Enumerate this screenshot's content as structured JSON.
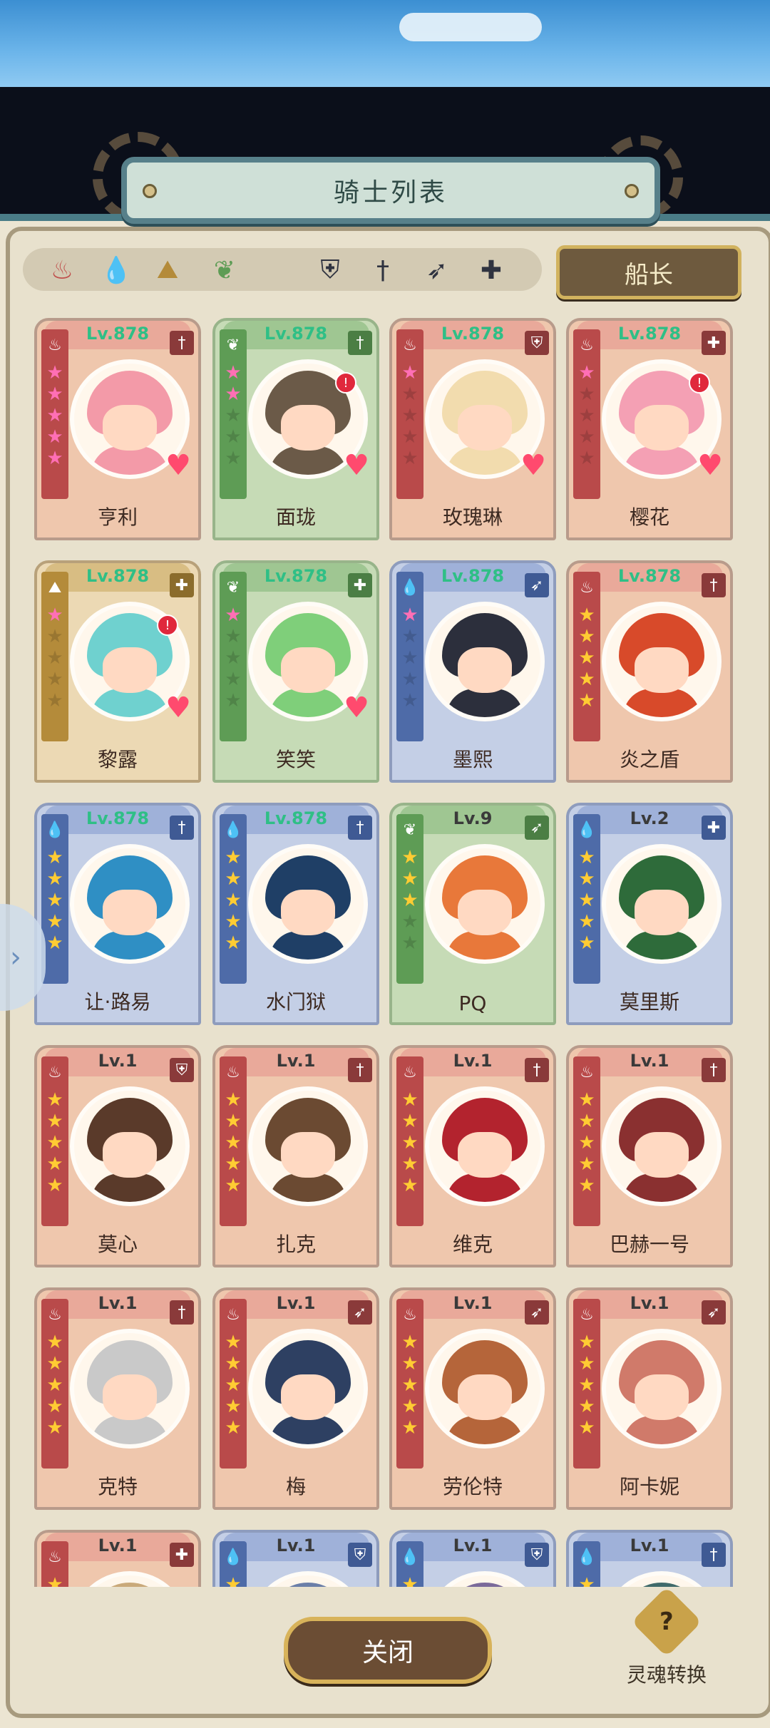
{
  "title": "骑士列表",
  "captain_button": "船长",
  "close_button": "关闭",
  "soul_convert": "灵魂转换",
  "soul_icon_glyph": "?",
  "filters": {
    "elements": [
      {
        "name": "fire-filter-icon",
        "glyph": "♨",
        "color": "#c0504d"
      },
      {
        "name": "water-filter-icon",
        "glyph": "💧",
        "color": "#4e6ba8"
      },
      {
        "name": "earth-filter-icon",
        "glyph": "⛰",
        "color": "#b48b3a"
      },
      {
        "name": "wood-filter-icon",
        "glyph": "❦",
        "color": "#5e9c55"
      }
    ],
    "classes": [
      {
        "name": "shield-filter-icon",
        "glyph": "⛨"
      },
      {
        "name": "sword-filter-icon",
        "glyph": "†"
      },
      {
        "name": "bow-filter-icon",
        "glyph": "➶"
      },
      {
        "name": "cross-filter-icon",
        "glyph": "✚"
      }
    ]
  },
  "knights": [
    {
      "name": "亨利",
      "level": "Lv.878",
      "max": true,
      "element": "fire",
      "stars": {
        "pink": 5,
        "gold": 0
      },
      "class_glyph": "†",
      "heart": true,
      "alert": false,
      "hair": "#f39aa8"
    },
    {
      "name": "面珑",
      "level": "Lv.878",
      "max": true,
      "element": "wood",
      "stars": {
        "pink": 2,
        "gold": 0
      },
      "class_glyph": "†",
      "heart": true,
      "alert": true,
      "hair": "#6b5a48"
    },
    {
      "name": "玫瑰琳",
      "level": "Lv.878",
      "max": true,
      "element": "fire",
      "stars": {
        "pink": 1,
        "gold": 0
      },
      "class_glyph": "⛨",
      "heart": true,
      "alert": false,
      "hair": "#f2dcae"
    },
    {
      "name": "樱花",
      "level": "Lv.878",
      "max": true,
      "element": "fire",
      "stars": {
        "pink": 1,
        "gold": 0
      },
      "class_glyph": "✚",
      "heart": true,
      "alert": true,
      "hair": "#f4a0b4"
    },
    {
      "name": "黎露",
      "level": "Lv.878",
      "max": true,
      "element": "earth",
      "stars": {
        "pink": 1,
        "gold": 0
      },
      "class_glyph": "✚",
      "heart": true,
      "alert": true,
      "hair": "#6fd1cf"
    },
    {
      "name": "笑笑",
      "level": "Lv.878",
      "max": true,
      "element": "wood",
      "stars": {
        "pink": 1,
        "gold": 0
      },
      "class_glyph": "✚",
      "heart": true,
      "alert": false,
      "hair": "#7fcf7a"
    },
    {
      "name": "墨熙",
      "level": "Lv.878",
      "max": true,
      "element": "water",
      "stars": {
        "pink": 1,
        "gold": 0
      },
      "class_glyph": "➶",
      "heart": false,
      "alert": false,
      "hair": "#2c2f3c"
    },
    {
      "name": "炎之盾",
      "level": "Lv.878",
      "max": true,
      "element": "fire",
      "stars": {
        "pink": 0,
        "gold": 5
      },
      "class_glyph": "†",
      "heart": false,
      "alert": false,
      "hair": "#d84a2a"
    },
    {
      "name": "让·路易",
      "level": "Lv.878",
      "max": true,
      "element": "water",
      "stars": {
        "pink": 0,
        "gold": 5
      },
      "class_glyph": "†",
      "heart": false,
      "alert": false,
      "hair": "#2f8fc4"
    },
    {
      "name": "水门狱",
      "level": "Lv.878",
      "max": true,
      "element": "water",
      "stars": {
        "pink": 0,
        "gold": 5
      },
      "class_glyph": "†",
      "heart": false,
      "alert": false,
      "hair": "#1f3f66"
    },
    {
      "name": "PQ",
      "level": "Lv.9",
      "max": false,
      "element": "wood",
      "stars": {
        "pink": 0,
        "gold": 3
      },
      "class_glyph": "➶",
      "heart": false,
      "alert": false,
      "hair": "#e8783a"
    },
    {
      "name": "莫里斯",
      "level": "Lv.2",
      "max": false,
      "element": "water",
      "stars": {
        "pink": 0,
        "gold": 5
      },
      "class_glyph": "✚",
      "heart": false,
      "alert": false,
      "hair": "#2e6b3a"
    },
    {
      "name": "莫心",
      "level": "Lv.1",
      "max": false,
      "element": "fire",
      "stars": {
        "pink": 0,
        "gold": 5
      },
      "class_glyph": "⛨",
      "heart": false,
      "alert": false,
      "hair": "#5a3a2a"
    },
    {
      "name": "扎克",
      "level": "Lv.1",
      "max": false,
      "element": "fire",
      "stars": {
        "pink": 0,
        "gold": 5
      },
      "class_glyph": "†",
      "heart": false,
      "alert": false,
      "hair": "#6b4a32"
    },
    {
      "name": "维克",
      "level": "Lv.1",
      "max": false,
      "element": "fire",
      "stars": {
        "pink": 0,
        "gold": 5
      },
      "class_glyph": "†",
      "heart": false,
      "alert": false,
      "hair": "#b3232e"
    },
    {
      "name": "巴赫一号",
      "level": "Lv.1",
      "max": false,
      "element": "fire",
      "stars": {
        "pink": 0,
        "gold": 5
      },
      "class_glyph": "†",
      "heart": false,
      "alert": false,
      "hair": "#8a3030"
    },
    {
      "name": "克特",
      "level": "Lv.1",
      "max": false,
      "element": "fire",
      "stars": {
        "pink": 0,
        "gold": 5
      },
      "class_glyph": "†",
      "heart": false,
      "alert": false,
      "hair": "#c9c9c9"
    },
    {
      "name": "梅",
      "level": "Lv.1",
      "max": false,
      "element": "fire",
      "stars": {
        "pink": 0,
        "gold": 5
      },
      "class_glyph": "➶",
      "heart": false,
      "alert": false,
      "hair": "#2e4062"
    },
    {
      "name": "劳伦特",
      "level": "Lv.1",
      "max": false,
      "element": "fire",
      "stars": {
        "pink": 0,
        "gold": 5
      },
      "class_glyph": "➶",
      "heart": false,
      "alert": false,
      "hair": "#b5653a"
    },
    {
      "name": "阿卡妮",
      "level": "Lv.1",
      "max": false,
      "element": "fire",
      "stars": {
        "pink": 0,
        "gold": 5
      },
      "class_glyph": "➶",
      "heart": false,
      "alert": false,
      "hair": "#d07a6a"
    },
    {
      "name": "",
      "level": "Lv.1",
      "max": false,
      "element": "fire",
      "stars": {
        "pink": 0,
        "gold": 5
      },
      "class_glyph": "✚",
      "heart": false,
      "alert": false,
      "hair": "#c9a97a"
    },
    {
      "name": "",
      "level": "Lv.1",
      "max": false,
      "element": "water",
      "stars": {
        "pink": 0,
        "gold": 5
      },
      "class_glyph": "⛨",
      "heart": false,
      "alert": false,
      "hair": "#6b7fa8"
    },
    {
      "name": "",
      "level": "Lv.1",
      "max": false,
      "element": "water",
      "stars": {
        "pink": 0,
        "gold": 5
      },
      "class_glyph": "⛨",
      "heart": false,
      "alert": false,
      "hair": "#7a6a9a"
    },
    {
      "name": "",
      "level": "Lv.1",
      "max": false,
      "element": "water",
      "stars": {
        "pink": 0,
        "gold": 5
      },
      "class_glyph": "†",
      "heart": false,
      "alert": false,
      "hair": "#3f6a6a"
    }
  ],
  "element_glyphs": {
    "fire": "♨",
    "wood": "❦",
    "water": "💧",
    "earth": "⛰"
  },
  "side_tab_glyph": "›"
}
